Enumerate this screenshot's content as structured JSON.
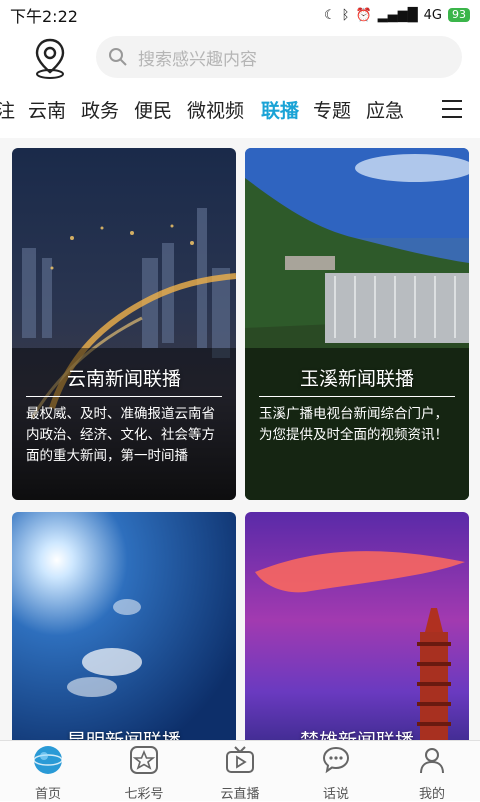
{
  "status_bar": {
    "time": "下午2:22",
    "network": "4G",
    "battery": "93"
  },
  "header": {
    "search_placeholder": "搜索感兴趣内容"
  },
  "tabs": [
    {
      "label": "注"
    },
    {
      "label": "云南"
    },
    {
      "label": "政务"
    },
    {
      "label": "便民"
    },
    {
      "label": "微视频"
    },
    {
      "label": "联播",
      "active": true
    },
    {
      "label": "专题"
    },
    {
      "label": "应急"
    }
  ],
  "cards": [
    {
      "title": "云南新闻联播",
      "desc": "最权威、及时、准确报道云南省内政治、经济、文化、社会等方面的重大新闻，第一时间播"
    },
    {
      "title": "玉溪新闻联播",
      "desc": "玉溪广播电视台新闻综合门户，为您提供及时全面的视频资讯！"
    },
    {
      "title": "昆明新闻联播",
      "desc": ""
    },
    {
      "title": "楚雄新闻联播",
      "desc": ""
    }
  ],
  "bottom_nav": [
    {
      "label": "首页",
      "active": true
    },
    {
      "label": "七彩号"
    },
    {
      "label": "云直播"
    },
    {
      "label": "话说"
    },
    {
      "label": "我的"
    }
  ],
  "colors": {
    "accent": "#1aa3d6"
  }
}
